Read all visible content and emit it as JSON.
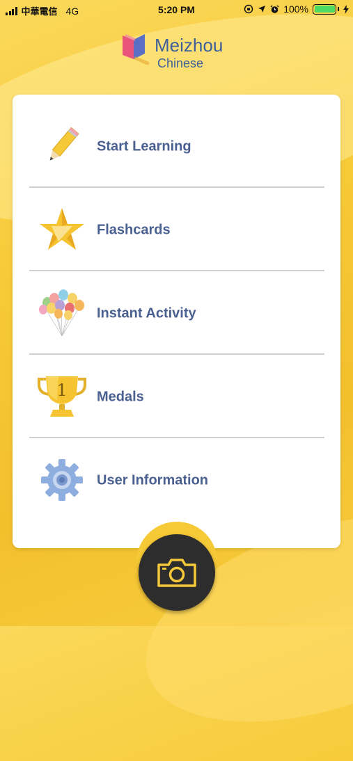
{
  "status_bar": {
    "carrier": "中華電信",
    "network": "4G",
    "time": "5:20 PM",
    "battery": "100%"
  },
  "logo": {
    "name": "Meizhou",
    "subtitle": "Chinese"
  },
  "menu": {
    "items": [
      {
        "label": "Start Learning",
        "icon": "pencil-icon"
      },
      {
        "label": "Flashcards",
        "icon": "star-icon"
      },
      {
        "label": "Instant Activity",
        "icon": "balloons-icon"
      },
      {
        "label": "Medals",
        "icon": "trophy-icon"
      },
      {
        "label": "User Information",
        "icon": "gear-icon"
      }
    ]
  },
  "camera_button": {
    "icon": "camera-icon"
  },
  "colors": {
    "background": "#f6c936",
    "label": "#4a6090",
    "camera_button": "#2d2d2d",
    "camera_icon": "#f5c93a"
  }
}
